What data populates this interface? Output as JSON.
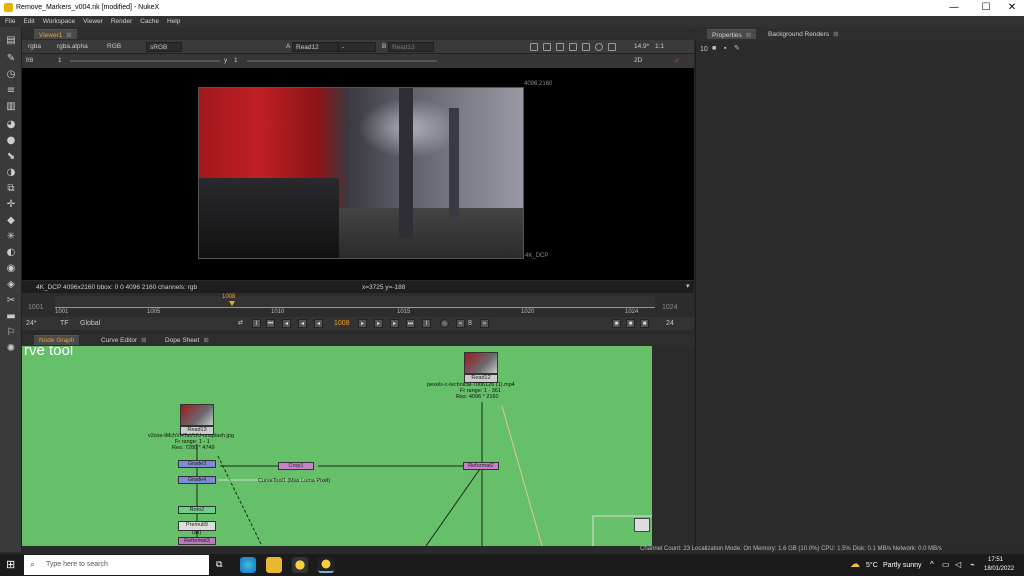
{
  "window": {
    "title": "Remove_Markers_v004.nk [modified] - NukeX",
    "minimize": "—",
    "maximize": "☐",
    "close": "✕"
  },
  "menu": [
    "File",
    "Edit",
    "Workspace",
    "Viewer",
    "Render",
    "Cache",
    "Help"
  ],
  "viewer": {
    "tab": "Viewer1",
    "channels": "rgba",
    "alpha": "rgba.alpha",
    "rgb": "RGB",
    "colorspace": "sRGB",
    "a_label": "A",
    "a_input": "Read12",
    "a_sep": "-",
    "b_label": "B",
    "b_input": "Read13",
    "gain": "14.9*",
    "zoom": "1:1",
    "fstop": "f/8",
    "frame_one": "1",
    "y_label": "y",
    "y_value": "1",
    "mode": "2D",
    "format_label_top": "4096,2160",
    "format_label_bottom": "4K_DCP",
    "info_left": "4K_DCP 4096x2160  bbox: 0 0 4096 2160 channels: rgb",
    "info_coords": "x=3725 y=-188"
  },
  "timeline": {
    "start": "1001",
    "end": "1024",
    "current": "1008",
    "ticks": [
      "1001",
      "1005",
      "1010",
      "1015",
      "1020",
      "1024"
    ],
    "fps": "24*",
    "tf": "TF",
    "scope": "Global",
    "frame_field": "1008",
    "step": "8",
    "end_field": "24"
  },
  "nodegraph": {
    "tabs": [
      "Node Graph",
      "Curve Editor",
      "Dope Sheet"
    ],
    "overlay_text": "rve tool",
    "read12": {
      "name": "Read12",
      "file": "pexels-c-technical-7006126 (1).mp4",
      "range": "Fr range: 1 - 361",
      "res": "Res: 4096 * 2160"
    },
    "read13": {
      "name": "Read13",
      "file": "v2oss-tMchVHTaVUU-unsplash.jpg",
      "range": "Fr range: 1 - 1",
      "res": "Res: 7280 * 4749"
    },
    "nodes": {
      "grade3": "Grade3",
      "grade4": "Grade4",
      "roto2": "Roto2",
      "premult": "Premult9",
      "premult_sub": "(all)",
      "reformat": "Reformat2",
      "crop": "Crop1",
      "reformat_small": "Reformat3"
    },
    "curve_label": "CurveTool1 (Max Luma Pixel)"
  },
  "properties": {
    "tabs": [
      "Properties",
      "Background Renders"
    ],
    "count": "10"
  },
  "status": "Channel Count: 23  Localization Mode: On  Memory: 1.6 GB (10.0%)  CPU: 1.5%  Disk: 0.1 MB/s  Network: 0.0 MB/s",
  "taskbar": {
    "search_placeholder": "Type here to search",
    "weather_temp": "5°C",
    "weather_text": "Partly sunny",
    "time": "17:51",
    "date": "18/01/2022"
  }
}
